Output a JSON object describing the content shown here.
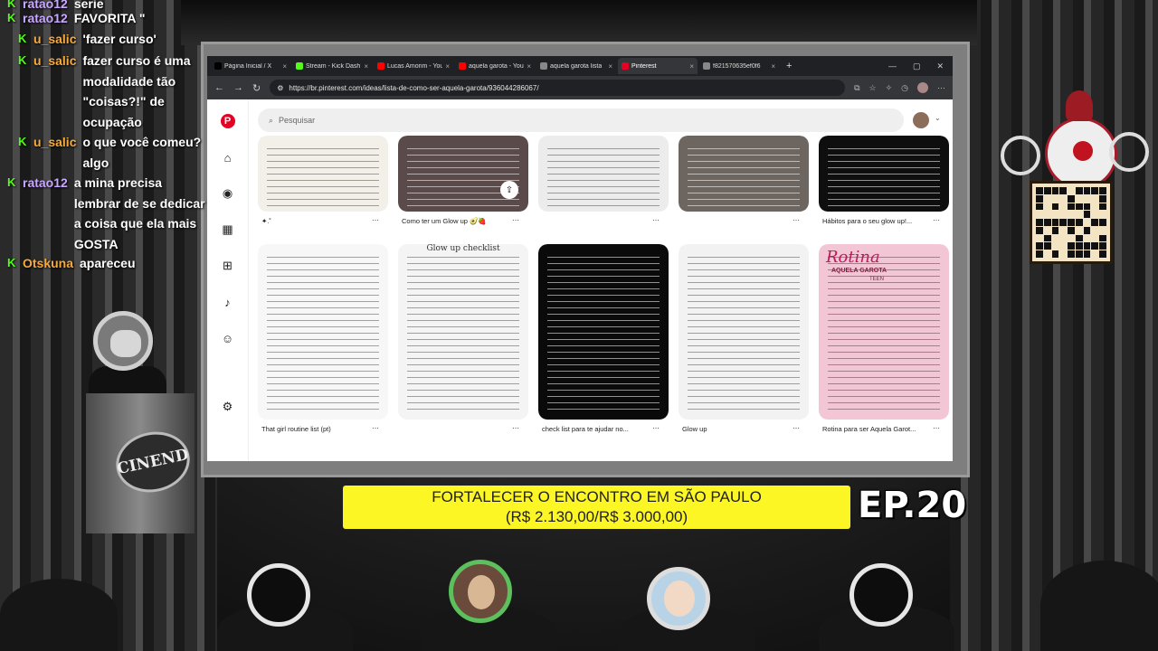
{
  "chat": {
    "messages": [
      {
        "user": "ratao12",
        "user_color": "#c9a8ff",
        "text": "serie"
      },
      {
        "user": "ratao12",
        "user_color": "#c9a8ff",
        "text": "FAVORITA \""
      },
      {
        "user": "u_salic",
        "user_color": "#f7a93b",
        "text": "'fazer curso'"
      },
      {
        "user": "u_salic",
        "user_color": "#f7a93b",
        "text": "fazer curso é uma modalidade tão \"coisas?!\" de ocupação"
      },
      {
        "user": "u_salic",
        "user_color": "#f7a93b",
        "text": "o que você comeu? algo"
      },
      {
        "user": "ratao12",
        "user_color": "#c9a8ff",
        "text": "a mina precisa lembrar de se dedicar a coisa que ela mais GOSTA"
      },
      {
        "user": "Otskuna",
        "user_color": "#f7a93b",
        "text": "apareceu"
      }
    ]
  },
  "browser": {
    "tabs": [
      {
        "label": "Página Inicial / X",
        "favicon_color": "#000000"
      },
      {
        "label": "Stream - Kick Dash",
        "favicon_color": "#53fc18"
      },
      {
        "label": "Lucas Amorim - YouTube",
        "favicon_color": "#ff0000"
      },
      {
        "label": "aquela garota - YouTube",
        "favicon_color": "#ff0000"
      },
      {
        "label": "aquela garota lista",
        "favicon_color": "#888888"
      },
      {
        "label": "Pinterest",
        "favicon_color": "#e60023"
      },
      {
        "label": "f821570635ef0f6",
        "favicon_color": "#888888"
      }
    ],
    "active_tab": 5,
    "new_tab_symbol": "+",
    "url": "https://br.pinterest.com/ideas/lista-de-como-ser-aquela-garota/936044286067/"
  },
  "pinterest": {
    "logo": "P",
    "search_placeholder": "Pesquisar",
    "sidebar_icons": [
      "home-icon",
      "explore-icon",
      "boards-icon",
      "create-icon",
      "notifications-icon",
      "messages-icon",
      "settings-icon"
    ],
    "row1": [
      {
        "caption": "✦.˚",
        "color": "#f3f0ea",
        "dark": false
      },
      {
        "caption": "Como ter um Glow up 🥑🍓",
        "color": "#5a4a4a",
        "dark": true
      },
      {
        "caption": "",
        "color": "#ececec",
        "dark": false
      },
      {
        "caption": "",
        "color": "#6d6560",
        "dark": true
      },
      {
        "caption": "Hábitos para o seu glow up!...",
        "color": "#0e0e0e",
        "dark": true
      }
    ],
    "row2": [
      {
        "caption": "That girl routine list (pt)",
        "color": "#f7f7f7",
        "dark": false
      },
      {
        "caption": "",
        "color": "#f4f4f4",
        "dark": false
      },
      {
        "caption": "check list para te ajudar no...",
        "color": "#0a0a0a",
        "dark": true
      },
      {
        "caption": "Glow up",
        "color": "#f2f2f2",
        "dark": false
      },
      {
        "caption": "Rotina para ser Aquela Garot...",
        "color": "#f3c6d6",
        "dark": false
      }
    ],
    "pin_texts": {
      "glow_up_checklist": "Glow up checklist",
      "rotina": "Rotina",
      "aquela_garota": "AQUELA GAROTA",
      "teen": "TEEN"
    }
  },
  "ticker": {
    "line1": "FORTALECER O ENCONTRO EM SÃO PAULO",
    "line2": "(R$ 2.130,00/R$ 3.000,00)"
  },
  "episode": "EP.20",
  "podium_sign": "CINEND"
}
